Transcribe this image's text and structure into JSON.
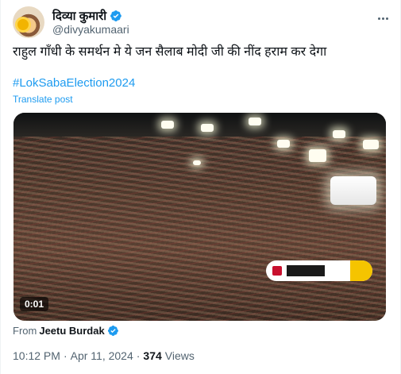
{
  "author": {
    "display_name": "दिव्या कुमारी",
    "handle": "@divyakumaari",
    "verified": true,
    "avatar_icon": "profile-avatar"
  },
  "menu": {
    "icon": "more-horizontal-icon"
  },
  "post": {
    "text": "राहुल गाँधी के समर्थन मे ये जन सैलाब मोदी जी की नींद हराम कर देगा",
    "hashtag": "#LokSabaElection2024",
    "translate_label": "Translate post"
  },
  "media": {
    "type": "video",
    "duration": "0:01"
  },
  "source": {
    "from_label": "From",
    "user": "Jeetu Burdak",
    "verified": true
  },
  "meta": {
    "time": "10:12 PM",
    "separator": "·",
    "date": "Apr 11, 2024",
    "views_count": "374",
    "views_label": "Views"
  },
  "colors": {
    "accent": "#1d9bf0",
    "text_primary": "#0f1419",
    "text_secondary": "#536471"
  }
}
